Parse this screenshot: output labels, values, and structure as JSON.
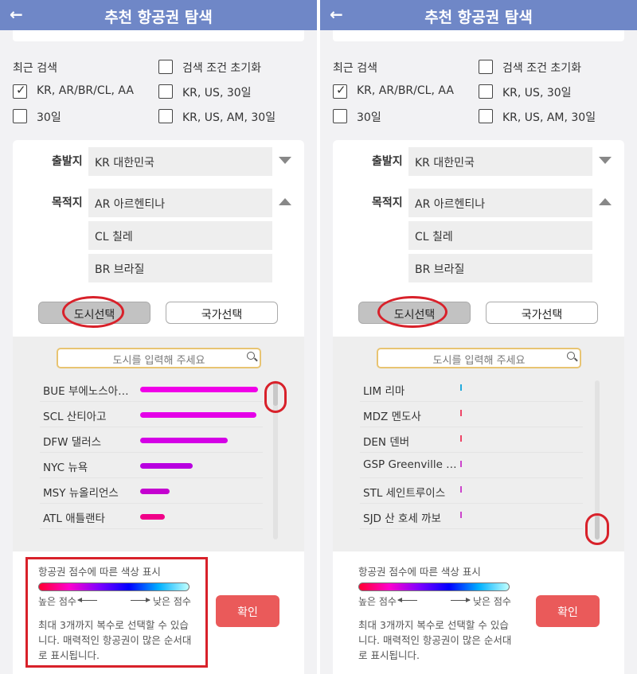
{
  "header": {
    "back_glyph": "←",
    "title": "추천 항공권 탐색"
  },
  "recent": {
    "label": "최근 검색",
    "reset_label": "검색 조건 초기화",
    "options": [
      {
        "label": "KR, AR/BR/CL, AA",
        "checked": true
      },
      {
        "label": "KR, US, 30일",
        "checked": false
      },
      {
        "label": "30일",
        "checked": false
      },
      {
        "label": "KR, US, AM, 30일",
        "checked": false
      }
    ]
  },
  "form": {
    "departure_label": "출발지",
    "departure_value": "KR 대한민국",
    "destination_label": "목적지",
    "destinations": [
      "AR 아르헨티나",
      "CL 칠레",
      "BR 브라질"
    ],
    "city_select_label": "도시선택",
    "country_select_label": "국가선택",
    "search_placeholder": "도시를 입력해 주세요"
  },
  "left_list": [
    {
      "name": "BUE 부에노스아…",
      "score": 0.85,
      "color": "#f000e8"
    },
    {
      "name": "SCL 산티아고",
      "score": 0.84,
      "color": "#e400e8"
    },
    {
      "name": "DFW 댈러스",
      "score": 0.63,
      "color": "#d400e6"
    },
    {
      "name": "NYC 뉴욕",
      "score": 0.38,
      "color": "#b800e0"
    },
    {
      "name": "MSY 뉴올리언스",
      "score": 0.21,
      "color": "#c400d0"
    },
    {
      "name": "ATL 애틀랜타",
      "score": 0.18,
      "color": "#f00088"
    }
  ],
  "right_list": [
    {
      "name": "LIM 리마",
      "color": "#22aadd"
    },
    {
      "name": "MDZ 멘도사",
      "color": "#ee4466"
    },
    {
      "name": "DEN 덴버",
      "color": "#ee4466"
    },
    {
      "name": "GSP Greenville …",
      "color": "#cc44cc"
    },
    {
      "name": "STL 세인트루이스",
      "color": "#cc44cc"
    },
    {
      "name": "SJD 산 호세 까보",
      "color": "#cc44cc"
    }
  ],
  "legend": {
    "title": "항공권 점수에 따른 색상 표시",
    "high": "높은 점수",
    "low": "낮은 점수",
    "note": "최대 3개까지 복수로 선택할 수 있습니다. 매력적인 항공권이 많은 순서대로 표시됩니다."
  },
  "confirm_label": "확인"
}
